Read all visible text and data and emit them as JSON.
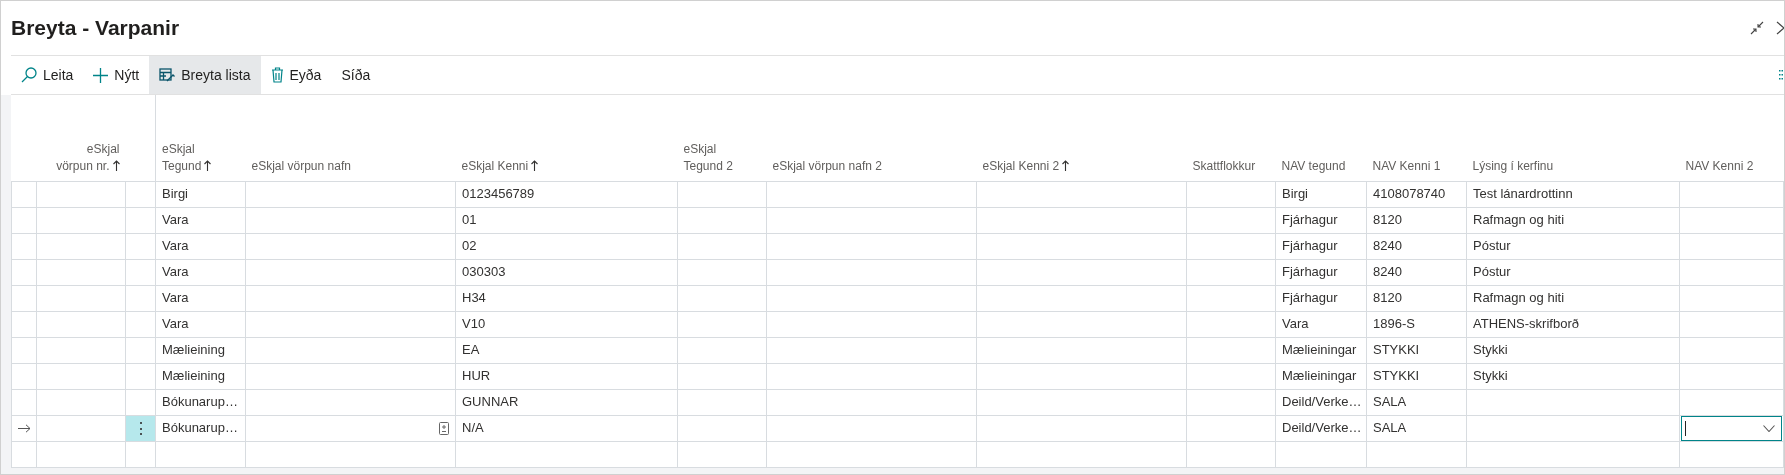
{
  "window": {
    "title": "Breyta - Varpanir"
  },
  "toolbar": [
    {
      "label": "Leita",
      "selected": false
    },
    {
      "label": "Nýtt",
      "selected": false
    },
    {
      "label": "Breyta lista",
      "selected": true
    },
    {
      "label": "Eyða",
      "selected": false
    },
    {
      "label": "Síða",
      "selected": false
    }
  ],
  "table": {
    "row_actions_label": "⋮",
    "columns": [
      {
        "label": "eSkjal vörpun nr.",
        "sorted": true
      },
      {
        "label": "eSkjal Tegund",
        "sorted": true
      },
      {
        "label": "eSkjal vörpun nafn",
        "sorted": false
      },
      {
        "label": "eSkjal Kenni",
        "sorted": true
      },
      {
        "label": "eSkjal Tegund 2",
        "sorted": false
      },
      {
        "label": "eSkjal vörpun nafn 2",
        "sorted": false
      },
      {
        "label": "eSkjal Kenni 2",
        "sorted": true
      },
      {
        "label": "Skattflokkur",
        "sorted": false
      },
      {
        "label": "NAV tegund",
        "sorted": false
      },
      {
        "label": "NAV Kenni 1",
        "sorted": false
      },
      {
        "label": "Lýsing í kerfinu",
        "sorted": false
      },
      {
        "label": "NAV Kenni 2",
        "sorted": false
      }
    ],
    "rows": [
      {
        "selected": false,
        "tegund": "Birgi",
        "kenni": "0123456789",
        "nav_tegund": "Birgi",
        "nav_kenni1": "4108078740",
        "lysing": "Test lánardrottinn"
      },
      {
        "selected": false,
        "tegund": "Vara",
        "kenni": "01",
        "nav_tegund": "Fjárhagur",
        "nav_kenni1": "8120",
        "lysing": "Rafmagn og hiti"
      },
      {
        "selected": false,
        "tegund": "Vara",
        "kenni": "02",
        "nav_tegund": "Fjárhagur",
        "nav_kenni1": "8240",
        "lysing": "Póstur"
      },
      {
        "selected": false,
        "tegund": "Vara",
        "kenni": "030303",
        "nav_tegund": "Fjárhagur",
        "nav_kenni1": "8240",
        "lysing": "Póstur"
      },
      {
        "selected": false,
        "tegund": "Vara",
        "kenni": "H34",
        "nav_tegund": "Fjárhagur",
        "nav_kenni1": "8120",
        "lysing": "Rafmagn og hiti"
      },
      {
        "selected": false,
        "tegund": "Vara",
        "kenni": "V10",
        "nav_tegund": "Vara",
        "nav_kenni1": "1896-S",
        "lysing": "ATHENS-skrifborð"
      },
      {
        "selected": false,
        "tegund": "Mælieining",
        "kenni": "EA",
        "nav_tegund": "Mælieiningar",
        "nav_kenni1": "STYKKI",
        "lysing": "Stykki"
      },
      {
        "selected": false,
        "tegund": "Mælieining",
        "kenni": "HUR",
        "nav_tegund": "Mælieiningar",
        "nav_kenni1": "STYKKI",
        "lysing": "Stykki"
      },
      {
        "selected": false,
        "tegund": "Bókunarup…",
        "kenni": "GUNNAR",
        "nav_tegund": "Deild/Verke…",
        "nav_kenni1": "SALA"
      },
      {
        "selected": true,
        "tegund": "Bókunarup…",
        "kenni": "N/A",
        "nav_tegund": "Deild/Verke…",
        "nav_kenni1": "SALA"
      }
    ]
  }
}
